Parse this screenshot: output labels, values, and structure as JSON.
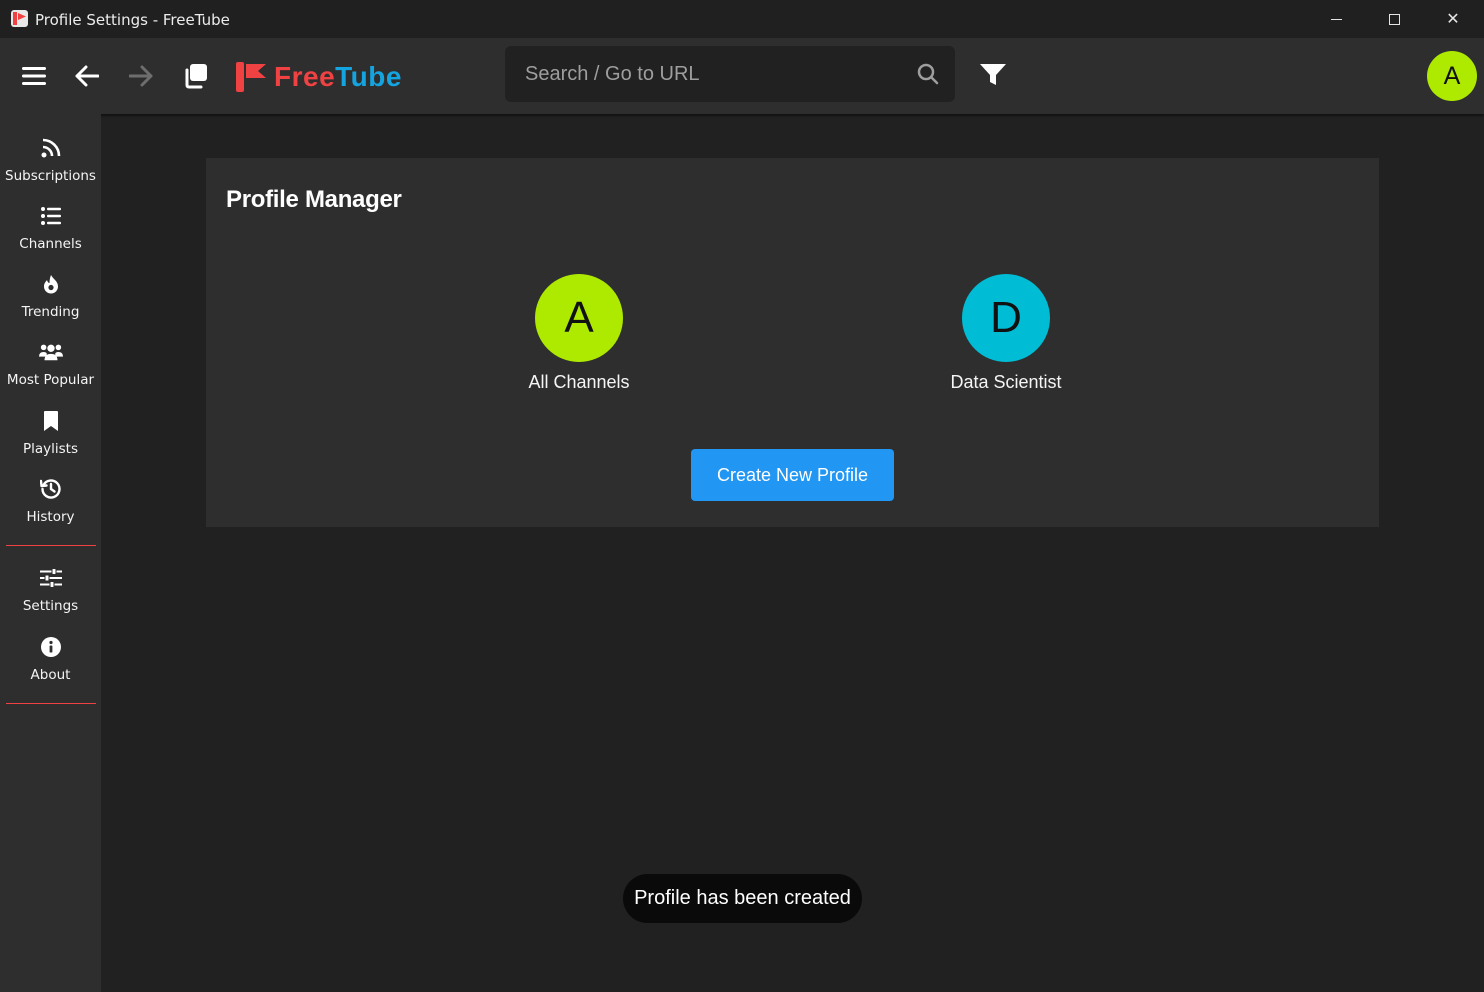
{
  "window": {
    "title": "Profile Settings - FreeTube",
    "minimize_glyph": "",
    "close_glyph": "✕"
  },
  "topnav": {
    "logo_free": "Free",
    "logo_tube": "Tube",
    "search_placeholder": "Search / Go to URL",
    "avatar_letter": "A",
    "avatar_color": "#aeea00"
  },
  "sidebar": {
    "items": [
      {
        "label": "Subscriptions",
        "icon": "rss-icon"
      },
      {
        "label": "Channels",
        "icon": "list-icon"
      },
      {
        "label": "Trending",
        "icon": "fire-icon"
      },
      {
        "label": "Most Popular",
        "icon": "users-icon"
      },
      {
        "label": "Playlists",
        "icon": "bookmark-icon"
      },
      {
        "label": "History",
        "icon": "history-icon"
      }
    ],
    "bottom_items": [
      {
        "label": "Settings",
        "icon": "sliders-icon"
      },
      {
        "label": "About",
        "icon": "info-icon"
      }
    ],
    "divider_color": "#f04242"
  },
  "main": {
    "title": "Profile Manager",
    "profiles": [
      {
        "letter": "A",
        "name": "All Channels",
        "color": "#aeea00"
      },
      {
        "letter": "D",
        "name": "Data Scientist",
        "color": "#00bcd4"
      }
    ],
    "create_button": "Create New Profile",
    "accent_color": "#2196f3"
  },
  "toast": {
    "message": "Profile has been created"
  }
}
